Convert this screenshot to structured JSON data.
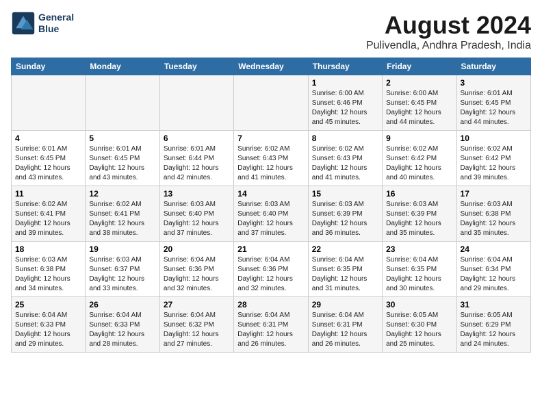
{
  "logo": {
    "line1": "General",
    "line2": "Blue"
  },
  "title": "August 2024",
  "subtitle": "Pulivendla, Andhra Pradesh, India",
  "headers": [
    "Sunday",
    "Monday",
    "Tuesday",
    "Wednesday",
    "Thursday",
    "Friday",
    "Saturday"
  ],
  "weeks": [
    [
      {
        "day": "",
        "info": ""
      },
      {
        "day": "",
        "info": ""
      },
      {
        "day": "",
        "info": ""
      },
      {
        "day": "",
        "info": ""
      },
      {
        "day": "1",
        "info": "Sunrise: 6:00 AM\nSunset: 6:46 PM\nDaylight: 12 hours\nand 45 minutes."
      },
      {
        "day": "2",
        "info": "Sunrise: 6:00 AM\nSunset: 6:45 PM\nDaylight: 12 hours\nand 44 minutes."
      },
      {
        "day": "3",
        "info": "Sunrise: 6:01 AM\nSunset: 6:45 PM\nDaylight: 12 hours\nand 44 minutes."
      }
    ],
    [
      {
        "day": "4",
        "info": "Sunrise: 6:01 AM\nSunset: 6:45 PM\nDaylight: 12 hours\nand 43 minutes."
      },
      {
        "day": "5",
        "info": "Sunrise: 6:01 AM\nSunset: 6:45 PM\nDaylight: 12 hours\nand 43 minutes."
      },
      {
        "day": "6",
        "info": "Sunrise: 6:01 AM\nSunset: 6:44 PM\nDaylight: 12 hours\nand 42 minutes."
      },
      {
        "day": "7",
        "info": "Sunrise: 6:02 AM\nSunset: 6:43 PM\nDaylight: 12 hours\nand 41 minutes."
      },
      {
        "day": "8",
        "info": "Sunrise: 6:02 AM\nSunset: 6:43 PM\nDaylight: 12 hours\nand 41 minutes."
      },
      {
        "day": "9",
        "info": "Sunrise: 6:02 AM\nSunset: 6:42 PM\nDaylight: 12 hours\nand 40 minutes."
      },
      {
        "day": "10",
        "info": "Sunrise: 6:02 AM\nSunset: 6:42 PM\nDaylight: 12 hours\nand 39 minutes."
      }
    ],
    [
      {
        "day": "11",
        "info": "Sunrise: 6:02 AM\nSunset: 6:41 PM\nDaylight: 12 hours\nand 39 minutes."
      },
      {
        "day": "12",
        "info": "Sunrise: 6:02 AM\nSunset: 6:41 PM\nDaylight: 12 hours\nand 38 minutes."
      },
      {
        "day": "13",
        "info": "Sunrise: 6:03 AM\nSunset: 6:40 PM\nDaylight: 12 hours\nand 37 minutes."
      },
      {
        "day": "14",
        "info": "Sunrise: 6:03 AM\nSunset: 6:40 PM\nDaylight: 12 hours\nand 37 minutes."
      },
      {
        "day": "15",
        "info": "Sunrise: 6:03 AM\nSunset: 6:39 PM\nDaylight: 12 hours\nand 36 minutes."
      },
      {
        "day": "16",
        "info": "Sunrise: 6:03 AM\nSunset: 6:39 PM\nDaylight: 12 hours\nand 35 minutes."
      },
      {
        "day": "17",
        "info": "Sunrise: 6:03 AM\nSunset: 6:38 PM\nDaylight: 12 hours\nand 35 minutes."
      }
    ],
    [
      {
        "day": "18",
        "info": "Sunrise: 6:03 AM\nSunset: 6:38 PM\nDaylight: 12 hours\nand 34 minutes."
      },
      {
        "day": "19",
        "info": "Sunrise: 6:03 AM\nSunset: 6:37 PM\nDaylight: 12 hours\nand 33 minutes."
      },
      {
        "day": "20",
        "info": "Sunrise: 6:04 AM\nSunset: 6:36 PM\nDaylight: 12 hours\nand 32 minutes."
      },
      {
        "day": "21",
        "info": "Sunrise: 6:04 AM\nSunset: 6:36 PM\nDaylight: 12 hours\nand 32 minutes."
      },
      {
        "day": "22",
        "info": "Sunrise: 6:04 AM\nSunset: 6:35 PM\nDaylight: 12 hours\nand 31 minutes."
      },
      {
        "day": "23",
        "info": "Sunrise: 6:04 AM\nSunset: 6:35 PM\nDaylight: 12 hours\nand 30 minutes."
      },
      {
        "day": "24",
        "info": "Sunrise: 6:04 AM\nSunset: 6:34 PM\nDaylight: 12 hours\nand 29 minutes."
      }
    ],
    [
      {
        "day": "25",
        "info": "Sunrise: 6:04 AM\nSunset: 6:33 PM\nDaylight: 12 hours\nand 29 minutes."
      },
      {
        "day": "26",
        "info": "Sunrise: 6:04 AM\nSunset: 6:33 PM\nDaylight: 12 hours\nand 28 minutes."
      },
      {
        "day": "27",
        "info": "Sunrise: 6:04 AM\nSunset: 6:32 PM\nDaylight: 12 hours\nand 27 minutes."
      },
      {
        "day": "28",
        "info": "Sunrise: 6:04 AM\nSunset: 6:31 PM\nDaylight: 12 hours\nand 26 minutes."
      },
      {
        "day": "29",
        "info": "Sunrise: 6:04 AM\nSunset: 6:31 PM\nDaylight: 12 hours\nand 26 minutes."
      },
      {
        "day": "30",
        "info": "Sunrise: 6:05 AM\nSunset: 6:30 PM\nDaylight: 12 hours\nand 25 minutes."
      },
      {
        "day": "31",
        "info": "Sunrise: 6:05 AM\nSunset: 6:29 PM\nDaylight: 12 hours\nand 24 minutes."
      }
    ]
  ]
}
